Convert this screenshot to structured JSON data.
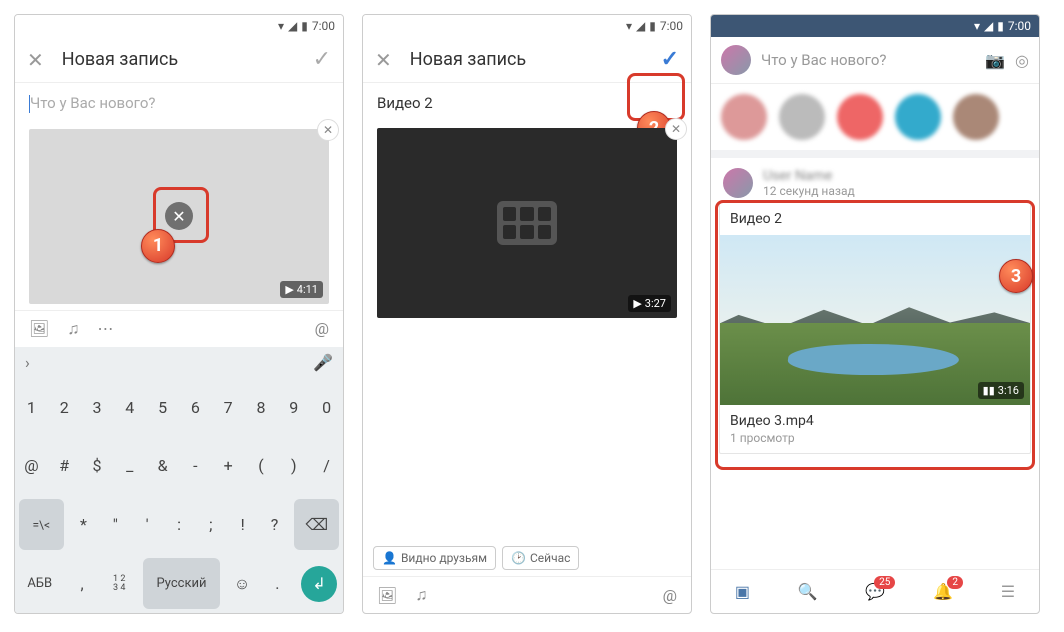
{
  "status": {
    "time": "7:00"
  },
  "s1": {
    "title": "Новая запись",
    "placeholder": "Что у Вас нового?",
    "duration": "4:11",
    "kb": {
      "row1": [
        "1",
        "2",
        "3",
        "4",
        "5",
        "6",
        "7",
        "8",
        "9",
        "0"
      ],
      "row2": [
        "@",
        "#",
        "$",
        "_",
        "&",
        "-",
        "+",
        "(",
        ")",
        "/"
      ],
      "row3_lead": "=\\<",
      "row3": [
        "*",
        "\"",
        "'",
        ":",
        ";",
        "!",
        "?"
      ],
      "abc": "АБВ",
      "comma": ",",
      "nums": "1234",
      "lang": "Русский",
      "smile": "☺",
      "dot": "."
    }
  },
  "s2": {
    "title": "Новая запись",
    "video_title": "Видео 2",
    "duration": "3:27",
    "chip1": "Видно друзьям",
    "chip2": "Сейчас"
  },
  "s3": {
    "prompt": "Что у Вас нового?",
    "post_author": "User Name",
    "post_time": "12 секунд назад",
    "card_title": "Видео 2",
    "duration": "3:16",
    "file_name": "Видео 3.mp4",
    "views": "1 просмотр",
    "badge_msg": "25",
    "badge_notif": "2"
  },
  "callouts": {
    "b1": "1",
    "b2": "2",
    "b3": "3"
  }
}
